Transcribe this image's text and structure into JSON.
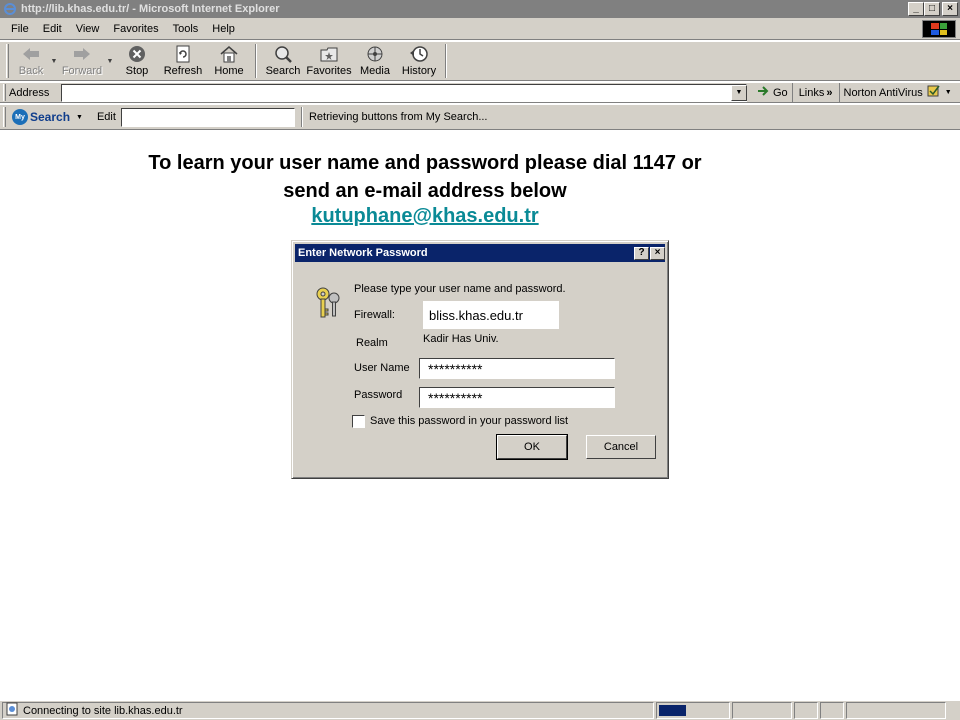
{
  "window": {
    "title": "http://lib.khas.edu.tr/ - Microsoft Internet Explorer",
    "buttons": {
      "minimize": "_",
      "maximize": "□",
      "close": "×"
    }
  },
  "menu": [
    "File",
    "Edit",
    "View",
    "Favorites",
    "Tools",
    "Help"
  ],
  "toolbar": {
    "back": "Back",
    "forward": "Forward",
    "stop": "Stop",
    "refresh": "Refresh",
    "home": "Home",
    "search": "Search",
    "favorites": "Favorites",
    "media": "Media",
    "history": "History"
  },
  "address": {
    "label": "Address",
    "value": "",
    "go": "Go",
    "links": "Links",
    "links_chevron": "»",
    "norton": "Norton AntiVirus"
  },
  "mysearch": {
    "logo_text": "Search",
    "logo_badge": "My",
    "edit_label": "Edit",
    "edit_value": "",
    "status": "Retrieving buttons from My Search..."
  },
  "page": {
    "instructions_line1": "To learn your user name and password please dial 1147 or",
    "instructions_line2": "send an e-mail address below",
    "email": "kutuphane@khas.edu.tr"
  },
  "dialog": {
    "title": "Enter Network Password",
    "help_btn": "?",
    "close_btn": "×",
    "prompt": "Please type your user name and password.",
    "firewall_label": "Firewall:",
    "firewall_value": "bliss.khas.edu.tr",
    "realm_label": "Realm",
    "realm_value": "Kadir Has Univ.",
    "username_label": "User Name",
    "username_value": "**********",
    "password_label": "Password",
    "password_value": "**********",
    "save_label": "Save this password in your password list",
    "save_checked": false,
    "ok": "OK",
    "cancel": "Cancel"
  },
  "status": {
    "text": "Connecting to site lib.khas.edu.tr",
    "progress": 0.4
  },
  "colors": {
    "chrome": "#d4d0c8",
    "titlebar_inactive": "#808080",
    "dialog_title": "#0a246a",
    "link": "#0a8a96"
  }
}
